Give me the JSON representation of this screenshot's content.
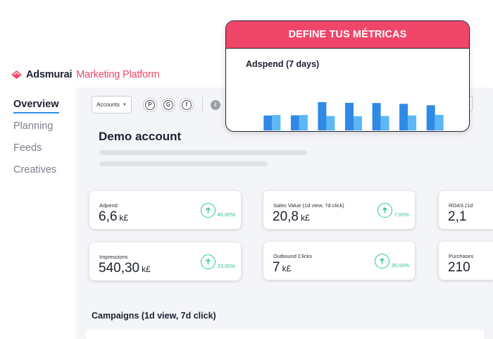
{
  "brand": {
    "name": "Adsmurai",
    "subtitle": "Marketing Platform",
    "accent": "#f0466a"
  },
  "nav": {
    "items": [
      {
        "label": "Overview",
        "active": true
      },
      {
        "label": "Planning",
        "active": false
      },
      {
        "label": "Feeds",
        "active": false
      },
      {
        "label": "Creatives",
        "active": false
      }
    ]
  },
  "toolbar": {
    "accounts_label": "Accounts",
    "platforms": [
      "pinterest-icon",
      "google-icon",
      "facebook-icon"
    ],
    "info_icon": "i"
  },
  "account": {
    "title": "Demo account"
  },
  "metrics": [
    {
      "label": "Adpend",
      "value": "6,6",
      "unit": "k£",
      "change": "46,00%",
      "trend": "up"
    },
    {
      "label": "Sales Value (1d view, 7d click)",
      "value": "20,8",
      "unit": "k£",
      "change": "7,00%",
      "trend": "up"
    },
    {
      "label": "ROAS (1d",
      "value": "2,1",
      "unit": "",
      "change": "",
      "trend": ""
    },
    {
      "label": "Impressions",
      "value": "540,30",
      "unit": "k£",
      "change": "23,00%",
      "trend": "up"
    },
    {
      "label": "Outbound Clicks",
      "value": "7",
      "unit": "k£",
      "change": "35,00%",
      "trend": "up"
    },
    {
      "label": "Purchases",
      "value": "210",
      "unit": "",
      "change": "",
      "trend": ""
    }
  ],
  "campaigns": {
    "title": "Campaigns (1d view, 7d click)"
  },
  "popup": {
    "header": "DEFINE TUS MÉTRICAS",
    "chart_title": "Adspend (7 days)"
  },
  "colors": {
    "positive": "#2bc49a",
    "bar_primary": "#2f8ae6",
    "bar_secondary": "#5cb8f5"
  },
  "chart_data": {
    "type": "bar",
    "title": "Adspend (7 days)",
    "categories": [
      "",
      "",
      "",
      "",
      "",
      "",
      ""
    ],
    "series": [
      {
        "values": [
          620,
          630,
          1180,
          1150,
          1140,
          1110,
          1050
        ]
      },
      {
        "values": [
          640,
          640,
          600,
          590,
          600,
          620,
          650
        ]
      }
    ],
    "ylim": [
      0,
      2000
    ],
    "grid": false
  }
}
